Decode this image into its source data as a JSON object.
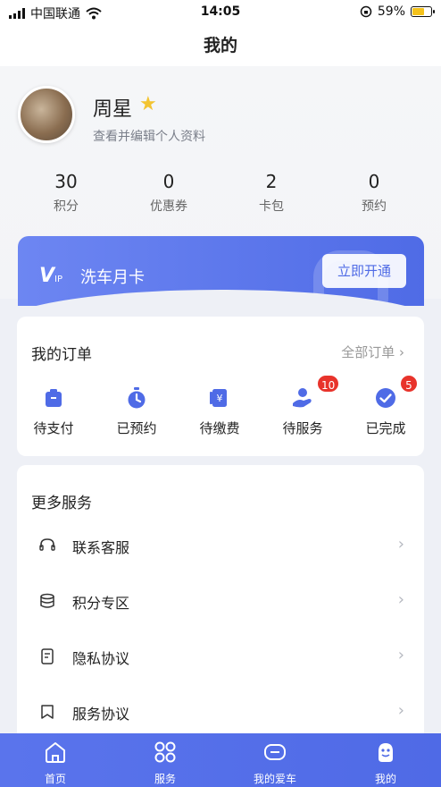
{
  "status_bar": {
    "carrier": "中国联通",
    "time": "14:05",
    "battery": "59%"
  },
  "nav": {
    "title": "我的"
  },
  "profile": {
    "name": "周星",
    "subtitle": "查看并编辑个人资料"
  },
  "stats": [
    {
      "value": "30",
      "label": "积分"
    },
    {
      "value": "0",
      "label": "优惠券"
    },
    {
      "value": "2",
      "label": "卡包"
    },
    {
      "value": "0",
      "label": "预约"
    }
  ],
  "vip": {
    "logo_v": "V",
    "logo_ip": "IP",
    "title": "洗车月卡",
    "button": "立即开通"
  },
  "orders": {
    "title": "我的订单",
    "all": "全部订单 ›",
    "items": [
      {
        "label": "待支付",
        "icon": "wallet-icon"
      },
      {
        "label": "已预约",
        "icon": "timer-icon"
      },
      {
        "label": "待缴费",
        "icon": "payment-icon"
      },
      {
        "label": "待服务",
        "icon": "service-hand-icon",
        "badge": "10"
      },
      {
        "label": "已完成",
        "icon": "check-circle-icon",
        "badge": "5"
      }
    ]
  },
  "services": {
    "title": "更多服务",
    "items": [
      {
        "label": "联系客服",
        "icon": "headset-icon"
      },
      {
        "label": "积分专区",
        "icon": "coins-icon"
      },
      {
        "label": "隐私协议",
        "icon": "document-icon"
      },
      {
        "label": "服务协议",
        "icon": "bookmark-icon"
      }
    ]
  },
  "tabbar": [
    {
      "label": "首页",
      "icon": "home-icon"
    },
    {
      "label": "服务",
      "icon": "grid-icon"
    },
    {
      "label": "我的爱车",
      "icon": "car-icon"
    },
    {
      "label": "我的",
      "icon": "user-icon",
      "active": true
    }
  ],
  "colors": {
    "accent": "#4f6be6",
    "badge": "#e8332b",
    "battery": "#f4c21b"
  }
}
